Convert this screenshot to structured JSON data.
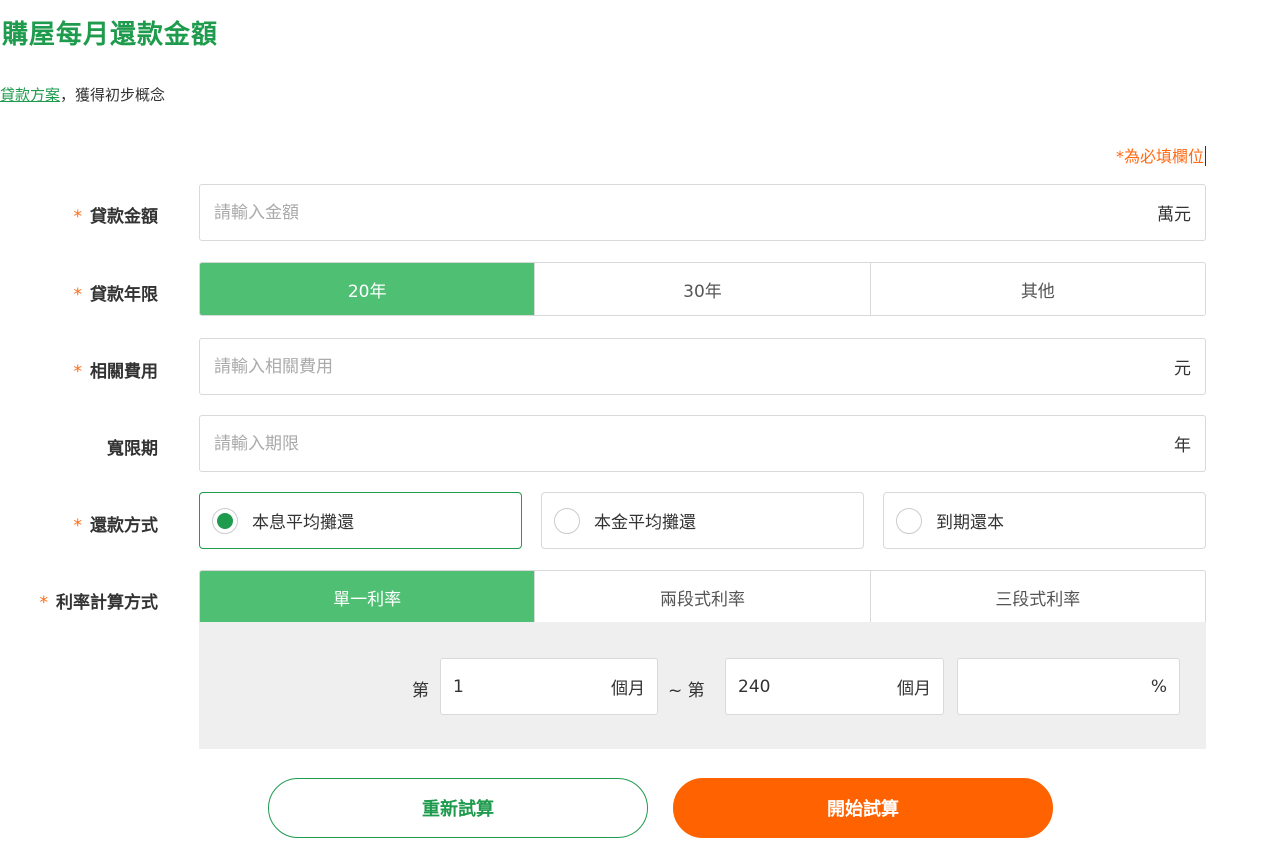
{
  "page": {
    "title": "購屋每月還款金額",
    "intro_link": "貸款方案",
    "intro_text": "，獲得初步概念",
    "required_note": "*為必填欄位"
  },
  "form": {
    "required_mark": "*",
    "loan_amount": {
      "label": "貸款金額",
      "placeholder": "請輸入金額",
      "value": "",
      "unit": "萬元"
    },
    "loan_term": {
      "label": "貸款年限",
      "options": [
        "20年",
        "30年",
        "其他"
      ],
      "selected": "20年"
    },
    "related_fees": {
      "label": "相關費用",
      "placeholder": "請輸入相關費用",
      "value": "",
      "unit": "元"
    },
    "grace_period": {
      "label": "寬限期",
      "placeholder": "請輸入期限",
      "value": "",
      "unit": "年"
    },
    "repayment_method": {
      "label": "還款方式",
      "options": [
        "本息平均攤還",
        "本金平均攤還",
        "到期還本"
      ],
      "selected": "本息平均攤還"
    },
    "rate_method": {
      "label": "利率計算方式",
      "options": [
        "單一利率",
        "兩段式利率",
        "三段式利率"
      ],
      "selected": "單一利率"
    },
    "rate_segment": {
      "prefix": "第",
      "start_month": "1",
      "month_unit": "個月",
      "separator": "~ 第",
      "end_month": "240",
      "rate_value": "",
      "rate_unit": "%"
    }
  },
  "buttons": {
    "reset": "重新試算",
    "start": "開始試算"
  },
  "colors": {
    "brand_green": "#1e9b4d",
    "active_green": "#4fbf74",
    "accent_orange": "#ff6200",
    "panel_gray": "#efefef"
  }
}
